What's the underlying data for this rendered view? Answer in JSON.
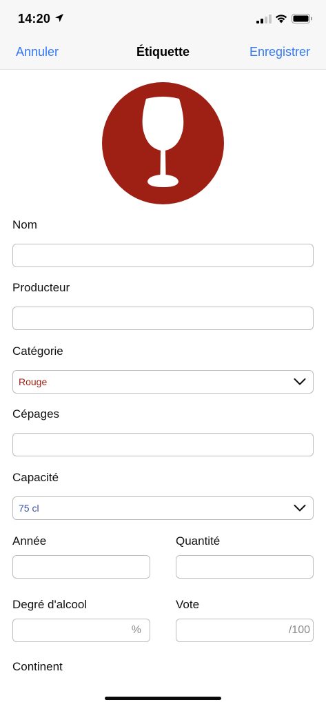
{
  "status_bar": {
    "time": "14:20",
    "location_icon": "location-arrow-icon",
    "signal_icon": "cellular-signal-icon",
    "wifi_icon": "wifi-icon",
    "battery_icon": "battery-icon"
  },
  "nav": {
    "cancel_label": "Annuler",
    "title": "Étiquette",
    "save_label": "Enregistrer",
    "accent_color": "#3478f6"
  },
  "badge": {
    "icon": "wine-glass-icon",
    "color": "#9e2015"
  },
  "form": {
    "nom": {
      "label": "Nom",
      "value": ""
    },
    "producteur": {
      "label": "Producteur",
      "value": ""
    },
    "categorie": {
      "label": "Catégorie",
      "value": "Rouge",
      "value_color": "#9e2015"
    },
    "cepages": {
      "label": "Cépages",
      "value": ""
    },
    "capacite": {
      "label": "Capacité",
      "value": "75 cl",
      "value_color": "#3a4fa8"
    },
    "annee": {
      "label": "Année",
      "value": ""
    },
    "quantite": {
      "label": "Quantité",
      "value": ""
    },
    "degre": {
      "label": "Degré d'alcool",
      "suffix": "%"
    },
    "vote": {
      "label": "Vote",
      "suffix": "/100"
    },
    "continent": {
      "label": "Continent"
    }
  }
}
